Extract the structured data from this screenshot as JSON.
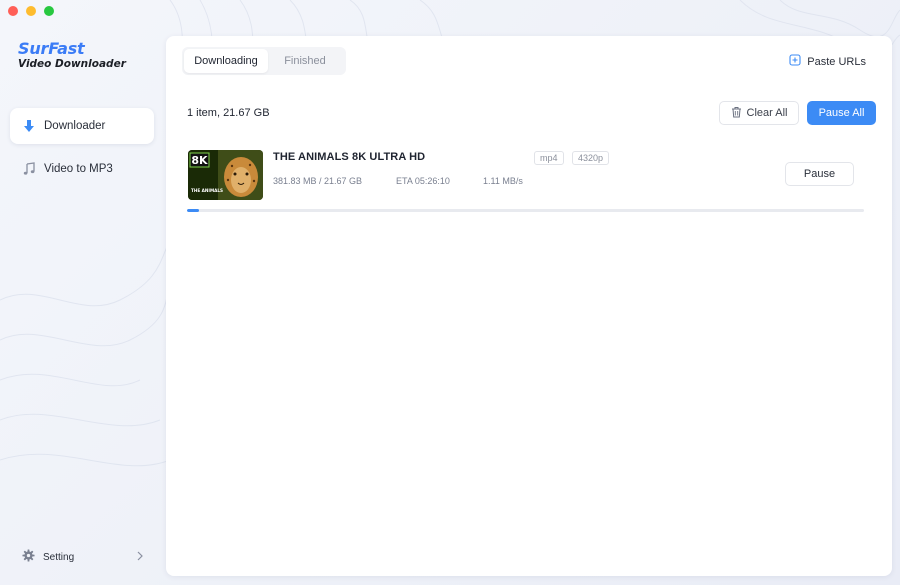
{
  "brand": {
    "name": "SurFast",
    "subtitle": "Video Downloader"
  },
  "sidebar": {
    "items": [
      {
        "label": "Downloader",
        "icon": "download-arrow-icon",
        "active": true
      },
      {
        "label": "Video to MP3",
        "icon": "music-note-icon",
        "active": false
      }
    ],
    "setting": {
      "label": "Setting",
      "icon": "gear-icon"
    }
  },
  "tabs": [
    {
      "label": "Downloading",
      "active": true
    },
    {
      "label": "Finished",
      "active": false
    }
  ],
  "toolbar": {
    "paste_label": "Paste URLs",
    "summary": "1 item, 21.67 GB",
    "clear_label": "Clear All",
    "pause_all_label": "Pause All"
  },
  "download": {
    "title": "THE ANIMALS 8K ULTRA HD",
    "format": "mp4",
    "resolution": "4320p",
    "size": "381.83 MB / 21.67 GB",
    "eta": "ETA 05:26:10",
    "speed": "1.11 MB/s",
    "pause_label": "Pause",
    "progress": 0.0172,
    "thumb_badge": "8K",
    "thumb_caption": "THE ANIMALS"
  },
  "colors": {
    "accent": "#3c8bf5",
    "brand": "#3b7cf6"
  }
}
